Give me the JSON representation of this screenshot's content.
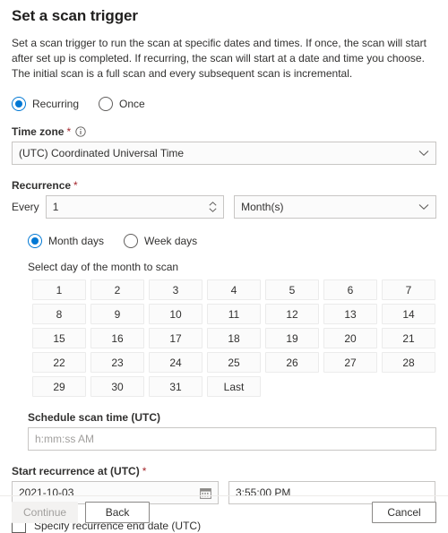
{
  "page": {
    "title": "Set a scan trigger",
    "description": "Set a scan trigger to run the scan at specific dates and times. If once, the scan will start after set up is completed. If recurring, the scan will start at a date and time you choose. The initial scan is a full scan and every subsequent scan is incremental."
  },
  "trigger_type": {
    "options": [
      {
        "label": "Recurring",
        "selected": true
      },
      {
        "label": "Once",
        "selected": false
      }
    ]
  },
  "timezone": {
    "label": "Time zone",
    "required_mark": "*",
    "info_icon": "info-circle-icon",
    "value": "(UTC) Coordinated Universal Time",
    "chevron_icon": "chevron-down-icon"
  },
  "recurrence": {
    "label": "Recurrence",
    "required_mark": "*",
    "every_label": "Every",
    "interval_value": "1",
    "spinner_up_icon": "chevron-up-icon",
    "spinner_down_icon": "chevron-down-icon",
    "unit_value": "Month(s)",
    "unit_chevron_icon": "chevron-down-icon"
  },
  "day_mode": {
    "options": [
      {
        "label": "Month days",
        "selected": true
      },
      {
        "label": "Week days",
        "selected": false
      }
    ]
  },
  "month_days": {
    "instruction": "Select day of the month to scan",
    "cells": [
      "1",
      "2",
      "3",
      "4",
      "5",
      "6",
      "7",
      "8",
      "9",
      "10",
      "11",
      "12",
      "13",
      "14",
      "15",
      "16",
      "17",
      "18",
      "19",
      "20",
      "21",
      "22",
      "23",
      "24",
      "25",
      "26",
      "27",
      "28",
      "29",
      "30",
      "31",
      "Last"
    ]
  },
  "schedule_scan_time": {
    "label": "Schedule scan time (UTC)",
    "placeholder": "h:mm:ss AM",
    "value": ""
  },
  "start_recurrence": {
    "label": "Start recurrence at (UTC)",
    "required_mark": "*",
    "date_value": "2021-10-03",
    "calendar_icon": "calendar-icon",
    "time_value": "3:55:00 PM"
  },
  "end_date_checkbox": {
    "label": "Specify recurrence end date (UTC)",
    "checked": false
  },
  "footer": {
    "continue_label": "Continue",
    "continue_disabled": true,
    "back_label": "Back",
    "cancel_label": "Cancel"
  },
  "colors": {
    "accent": "#0078d4",
    "required": "#a4262c",
    "text": "#323130",
    "border": "#c8c6c4"
  }
}
